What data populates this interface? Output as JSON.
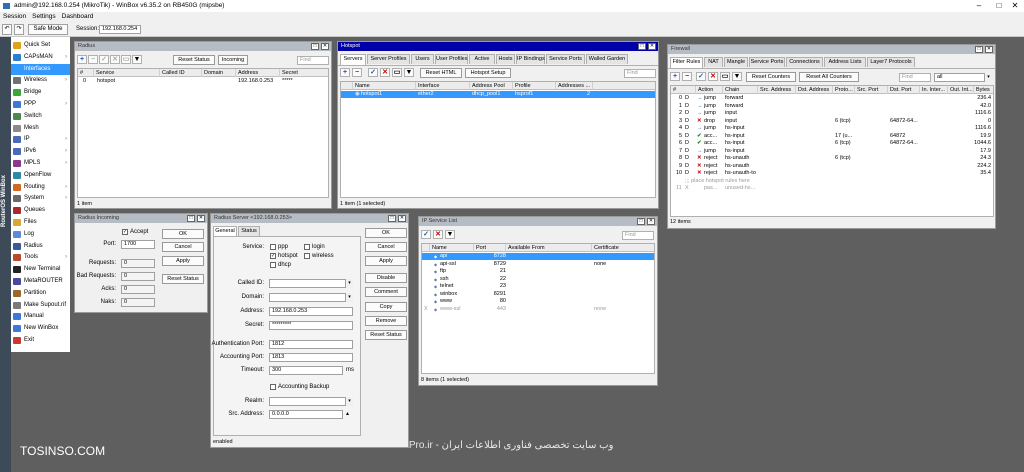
{
  "titlebar": {
    "title": "admin@192.168.0.254 (MikroTik) - WinBox v6.35.2 on RB450G (mipsbe)"
  },
  "menubar": {
    "session": "Session",
    "settings": "Settings",
    "dashboard": "Dashboard"
  },
  "toolbar": {
    "safe_mode": "Safe Mode",
    "session_label": "Session:",
    "session_value": "192.168.0.254"
  },
  "sidebar": {
    "vertical_text": "RouterOS WinBox"
  },
  "nav": {
    "items": [
      {
        "label": "Quick Set",
        "color": "#e0a020"
      },
      {
        "label": "CAPsMAN",
        "color": "#2c7fd0"
      },
      {
        "label": "Interfaces",
        "color": "#3399ff"
      },
      {
        "label": "Wireless",
        "color": "#707070"
      },
      {
        "label": "Bridge",
        "color": "#38a838"
      },
      {
        "label": "PPP",
        "color": "#3a7ad8"
      },
      {
        "label": "Switch",
        "color": "#4a8a4a"
      },
      {
        "label": "Mesh",
        "color": "#8a8a8a"
      },
      {
        "label": "IP",
        "color": "#4a6ab8"
      },
      {
        "label": "IPv6",
        "color": "#4a6ab8"
      },
      {
        "label": "MPLS",
        "color": "#8a3a8a"
      },
      {
        "label": "OpenFlow",
        "color": "#2a8aa8"
      },
      {
        "label": "Routing",
        "color": "#d06a20"
      },
      {
        "label": "System",
        "color": "#6a6a6a"
      },
      {
        "label": "Queues",
        "color": "#a82a2a"
      },
      {
        "label": "Files",
        "color": "#d8a830"
      },
      {
        "label": "Log",
        "color": "#5a8ad8"
      },
      {
        "label": "Radius",
        "color": "#3a5a9a"
      },
      {
        "label": "Tools",
        "color": "#b84a2a"
      },
      {
        "label": "New Terminal",
        "color": "#222222"
      },
      {
        "label": "MetaROUTER",
        "color": "#4a4a9a"
      },
      {
        "label": "Partition",
        "color": "#9a6a2a"
      },
      {
        "label": "Make Supout.rif",
        "color": "#7a7a7a"
      },
      {
        "label": "Manual",
        "color": "#3a7ad8"
      },
      {
        "label": "New WinBox",
        "color": "#3a7ad8"
      },
      {
        "label": "Exit",
        "color": "#c83a2a"
      }
    ]
  },
  "watermark": {
    "left": "TOSINSO.COM",
    "right": "ITPro.ir - وب سایت تخصصی فناوری اطلاعات ایران"
  },
  "radius": {
    "title": "Radius",
    "reset_status": "Reset Status",
    "incoming": "Incoming",
    "find": "Find",
    "columns": [
      "#",
      "Service",
      "Called ID",
      "Domain",
      "Address",
      "Secret"
    ],
    "rows": [
      {
        "num": "0",
        "service": "hotspot",
        "called_id": "",
        "domain": "",
        "address": "192.168.0.253",
        "secret": "*****"
      }
    ],
    "status": "1 item"
  },
  "hotspot": {
    "title": "Hotspot",
    "tabs": [
      "Servers",
      "Server Profiles",
      "Users",
      "User Profiles",
      "Active",
      "Hosts",
      "IP Bindings",
      "Service Ports",
      "Walled Garden"
    ],
    "reset_html": "Reset HTML",
    "hotspot_setup": "Hotspot Setup",
    "find": "Find",
    "columns": [
      "Name",
      "Interface",
      "Address Pool",
      "Profile",
      "Addresses ..."
    ],
    "rows": [
      {
        "name": "hotspot1",
        "interface": "ether2",
        "pool": "dhcp_pool1",
        "profile": "hsprof1",
        "addresses": "2"
      }
    ],
    "status": "1 item (1 selected)"
  },
  "firewall": {
    "title": "Firewall",
    "tabs": [
      "Filter Rules",
      "NAT",
      "Mangle",
      "Service Ports",
      "Connections",
      "Address Lists",
      "Layer7 Protocols"
    ],
    "reset_counters": "Reset Counters",
    "reset_all_counters": "Reset All Counters",
    "find": "Find",
    "filter": "all",
    "columns": [
      "#",
      "Action",
      "Chain",
      "Src. Address",
      "Dst. Address",
      "Proto...",
      "Src. Port",
      "Dst. Port",
      "In. Inter...",
      "Out. Int...",
      "Bytes"
    ],
    "rows": [
      {
        "num": "0",
        "flag": "D",
        "icon": "jump",
        "action": "jump",
        "chain": "forward",
        "proto": "",
        "dst_port": "",
        "bytes": "236.4"
      },
      {
        "num": "1",
        "flag": "D",
        "icon": "jump",
        "action": "jump",
        "chain": "forward",
        "proto": "",
        "dst_port": "",
        "bytes": "42.0"
      },
      {
        "num": "2",
        "flag": "D",
        "icon": "jump",
        "action": "jump",
        "chain": "input",
        "proto": "",
        "dst_port": "",
        "bytes": "1116.6"
      },
      {
        "num": "3",
        "flag": "D",
        "icon": "drop",
        "action": "drop",
        "chain": "input",
        "proto": "6 (tcp)",
        "dst_port": "64872-64...",
        "bytes": "0"
      },
      {
        "num": "4",
        "flag": "D",
        "icon": "jump",
        "action": "jump",
        "chain": "hs-input",
        "proto": "",
        "dst_port": "",
        "bytes": "1116.6"
      },
      {
        "num": "5",
        "flag": "D",
        "icon": "accept",
        "action": "acc...",
        "chain": "hs-input",
        "proto": "17 (u...",
        "dst_port": "64872",
        "bytes": "19.9"
      },
      {
        "num": "6",
        "flag": "D",
        "icon": "accept",
        "action": "acc...",
        "chain": "hs-input",
        "proto": "6 (tcp)",
        "dst_port": "64872-64...",
        "bytes": "1044.6"
      },
      {
        "num": "7",
        "flag": "D",
        "icon": "jump",
        "action": "jump",
        "chain": "hs-input",
        "proto": "",
        "dst_port": "",
        "bytes": "17.9"
      },
      {
        "num": "8",
        "flag": "D",
        "icon": "reject",
        "action": "reject",
        "chain": "hs-unauth",
        "proto": "6 (tcp)",
        "dst_port": "",
        "bytes": "24.3"
      },
      {
        "num": "9",
        "flag": "D",
        "icon": "reject",
        "action": "reject",
        "chain": "hs-unauth",
        "proto": "",
        "dst_port": "",
        "bytes": "224.2"
      },
      {
        "num": "10",
        "flag": "D",
        "icon": "reject",
        "action": "reject",
        "chain": "hs-unauth-to",
        "proto": "",
        "dst_port": "",
        "bytes": "35.4"
      }
    ],
    "comment_row": ";;; place hotspot rules here",
    "row11": {
      "num": "11",
      "flag": "X",
      "action": "pas...",
      "chain": "unused-hs..."
    },
    "status": "12 items"
  },
  "radius_incoming": {
    "title": "Radius Incoming",
    "accept": "Accept",
    "port_label": "Port:",
    "port_value": "1700",
    "requests_label": "Requests:",
    "requests_value": "0",
    "bad_requests_label": "Bad Requests:",
    "bad_requests_value": "0",
    "acks_label": "Acks:",
    "acks_value": "0",
    "naks_label": "Naks:",
    "naks_value": "0",
    "ok": "OK",
    "cancel": "Cancel",
    "apply": "Apply",
    "reset_status": "Reset Status"
  },
  "radius_server": {
    "title": "Radius Server <192.168.0.253>",
    "tab_general": "General",
    "tab_status": "Status",
    "service_label": "Service:",
    "svc_ppp": "ppp",
    "svc_login": "login",
    "svc_hotspot": "hotspot",
    "svc_wireless": "wireless",
    "svc_dhcp": "dhcp",
    "called_id_label": "Called ID:",
    "domain_label": "Domain:",
    "address_label": "Address:",
    "address_value": "192.168.0.253",
    "secret_label": "Secret:",
    "secret_value": "*********",
    "auth_port_label": "Authentication Port:",
    "auth_port_value": "1812",
    "acct_port_label": "Accounting Port:",
    "acct_port_value": "1813",
    "timeout_label": "Timeout:",
    "timeout_value": "300",
    "timeout_unit": "ms",
    "accounting_backup": "Accounting Backup",
    "realm_label": "Realm:",
    "src_address_label": "Src. Address:",
    "src_address_value": "0.0.0.0",
    "ok": "OK",
    "cancel": "Cancel",
    "apply": "Apply",
    "disable": "Disable",
    "comment": "Comment",
    "copy": "Copy",
    "remove": "Remove",
    "reset_status": "Reset Status",
    "status": "enabled"
  },
  "ip_service": {
    "title": "IP Service List",
    "find": "Find",
    "columns": [
      "Name",
      "Port",
      "Available From",
      "Certificate"
    ],
    "rows": [
      {
        "name": "api",
        "port": "8728",
        "from": "",
        "cert": "",
        "sel": true,
        "dis": false
      },
      {
        "name": "api-ssl",
        "port": "8729",
        "from": "",
        "cert": "none",
        "sel": false,
        "dis": false
      },
      {
        "name": "ftp",
        "port": "21",
        "from": "",
        "cert": "",
        "sel": false,
        "dis": false
      },
      {
        "name": "ssh",
        "port": "22",
        "from": "",
        "cert": "",
        "sel": false,
        "dis": false
      },
      {
        "name": "telnet",
        "port": "23",
        "from": "",
        "cert": "",
        "sel": false,
        "dis": false
      },
      {
        "name": "winbox",
        "port": "8291",
        "from": "",
        "cert": "",
        "sel": false,
        "dis": false
      },
      {
        "name": "www",
        "port": "80",
        "from": "",
        "cert": "",
        "sel": false,
        "dis": false
      },
      {
        "name": "www-ssl",
        "port": "443",
        "from": "",
        "cert": "none",
        "sel": false,
        "dis": true
      }
    ],
    "status": "8 items (1 selected)"
  }
}
